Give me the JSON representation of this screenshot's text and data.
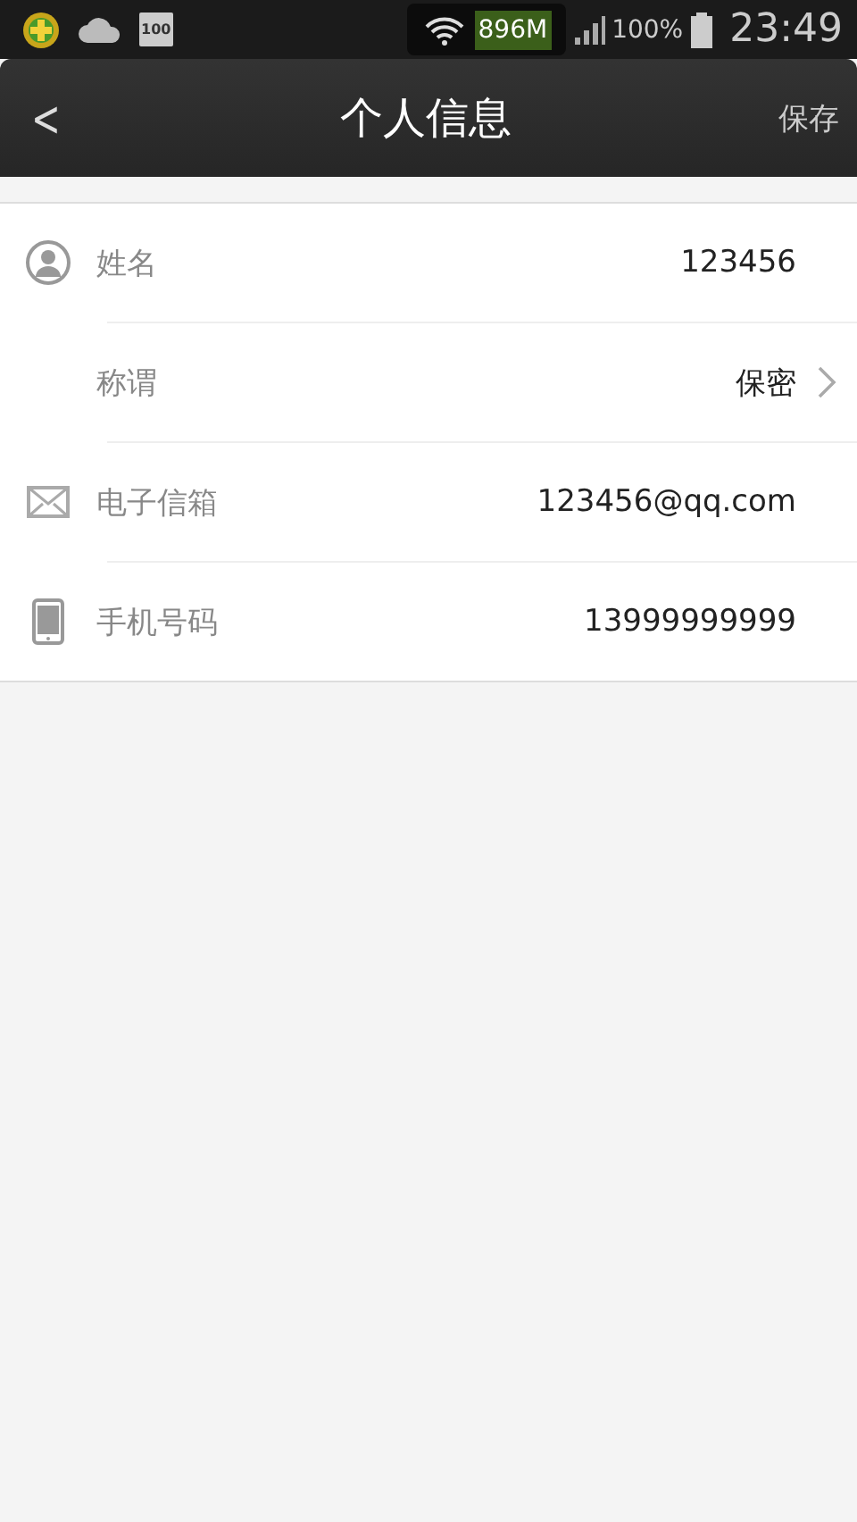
{
  "status_bar": {
    "notification_badge": "100",
    "data_usage": "896M",
    "battery": "100%",
    "time": "23:49"
  },
  "header": {
    "back": "<",
    "title": "个人信息",
    "action": "保存"
  },
  "fields": [
    {
      "kind": "person",
      "label": "姓名",
      "value": "123456",
      "chevron": false
    },
    {
      "kind": "plain",
      "label": "称谓",
      "value": "保密",
      "chevron": true
    },
    {
      "kind": "email",
      "label": "电子信箱",
      "value": "123456@qq.com",
      "chevron": false
    },
    {
      "kind": "phone",
      "label": "手机号码",
      "value": "13999999999",
      "chevron": false
    }
  ]
}
